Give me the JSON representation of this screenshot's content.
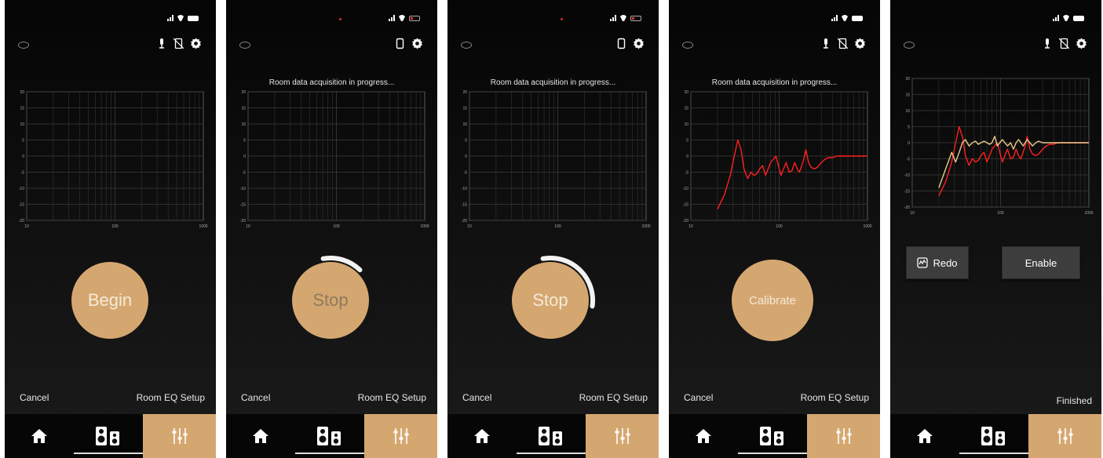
{
  "screens": [
    {
      "status": {
        "battery": "full",
        "red_dot": false
      },
      "top_icons": [
        "mic-icon",
        "phone-off-icon",
        "gear-icon"
      ],
      "message": "",
      "chart_data": {
        "type": "line",
        "y_ticks": [
          "20",
          "15",
          "10",
          "5",
          "0",
          "-5",
          "-10",
          "-15",
          "-20"
        ],
        "x_ticks": [
          "10",
          "100",
          "1000"
        ],
        "ylim": [
          -20,
          20
        ],
        "xlim": [
          10,
          1000
        ],
        "xscale": "log",
        "grid": true,
        "series": []
      },
      "action": {
        "kind": "circle",
        "label": "Begin",
        "progress": 0
      },
      "footer": {
        "left": "Cancel",
        "right": "Room EQ Setup"
      },
      "tabs": {
        "home_icon": "home-icon",
        "speaker_icon": "speakers-icon",
        "eq_icon": "eq-sliders-icon",
        "active": "eq"
      }
    },
    {
      "status": {
        "battery": "low",
        "red_dot": true
      },
      "top_icons": [
        "phone-icon",
        "gear-icon"
      ],
      "message": "Room data acquisition in progress...",
      "chart_data": {
        "type": "line",
        "y_ticks": [
          "20",
          "15",
          "10",
          "5",
          "0",
          "-5",
          "-10",
          "-15",
          "-20"
        ],
        "x_ticks": [
          "10",
          "100",
          "1000"
        ],
        "ylim": [
          -20,
          20
        ],
        "xlim": [
          10,
          1000
        ],
        "xscale": "log",
        "grid": true,
        "series": []
      },
      "action": {
        "kind": "circle",
        "label": "Stop",
        "progress": 0.15
      },
      "footer": {
        "left": "Cancel",
        "right": "Room EQ Setup"
      },
      "tabs": {
        "home_icon": "home-icon",
        "speaker_icon": "speakers-icon",
        "eq_icon": "eq-sliders-icon",
        "active": "eq"
      }
    },
    {
      "status": {
        "battery": "low",
        "red_dot": true
      },
      "top_icons": [
        "phone-icon",
        "gear-icon"
      ],
      "message": "Room data acquisition in progress...",
      "chart_data": {
        "type": "line",
        "y_ticks": [
          "20",
          "15",
          "10",
          "5",
          "0",
          "-5",
          "-10",
          "-15",
          "-20"
        ],
        "x_ticks": [
          "10",
          "100",
          "1000"
        ],
        "ylim": [
          -20,
          20
        ],
        "xlim": [
          10,
          1000
        ],
        "xscale": "log",
        "grid": true,
        "series": []
      },
      "action": {
        "kind": "circle",
        "label": "Stop",
        "progress": 0.3
      },
      "footer": {
        "left": "Cancel",
        "right": "Room EQ Setup"
      },
      "tabs": {
        "home_icon": "home-icon",
        "speaker_icon": "speakers-icon",
        "eq_icon": "eq-sliders-icon",
        "active": "eq"
      }
    },
    {
      "status": {
        "battery": "full",
        "red_dot": false
      },
      "top_icons": [
        "mic-icon",
        "phone-off-icon",
        "gear-icon"
      ],
      "message": "Room data acquisition in progress...",
      "chart_data": {
        "type": "line",
        "y_ticks": [
          "20",
          "15",
          "10",
          "5",
          "0",
          "-5",
          "-10",
          "-15",
          "-20"
        ],
        "x_ticks": [
          "10",
          "100",
          "1000"
        ],
        "ylim": [
          -20,
          20
        ],
        "xlim": [
          10,
          1000
        ],
        "xscale": "log",
        "grid": true,
        "series": [
          {
            "color": "#ff2020",
            "x": [
              20,
              24,
              28,
              31,
              34,
              37,
              40,
              44,
              48,
              52,
              56,
              60,
              65,
              70,
              75,
              80,
              86,
              92,
              98,
              105,
              112,
              120,
              130,
              140,
              150,
              160,
              170,
              180,
              190,
              200,
              215,
              230,
              250,
              270,
              300,
              330,
              360,
              400,
              450,
              500,
              600,
              700,
              800,
              900,
              1000
            ],
            "y": [
              -16.5,
              -12,
              -6,
              0,
              5,
              2,
              -4,
              -7,
              -5,
              -6,
              -5.5,
              -4,
              -3,
              -6,
              -4,
              -2,
              -1,
              0,
              -3,
              -6,
              -4,
              -2,
              -5,
              -4.5,
              -2,
              -4,
              -5,
              -3,
              -1,
              2,
              -2,
              -3.5,
              -4,
              -3.5,
              -2,
              -1,
              -0.5,
              -0.5,
              0,
              0,
              0,
              0,
              0,
              0,
              0
            ]
          }
        ]
      },
      "action": {
        "kind": "circle",
        "label": "Calibrate",
        "progress": 0
      },
      "footer": {
        "left": "Cancel",
        "right": "Room EQ Setup"
      },
      "tabs": {
        "home_icon": "home-icon",
        "speaker_icon": "speakers-icon",
        "eq_icon": "eq-sliders-icon",
        "active": "eq"
      }
    },
    {
      "status": {
        "battery": "full",
        "red_dot": false
      },
      "top_icons": [
        "mic-icon",
        "phone-off-icon",
        "gear-icon"
      ],
      "message": "",
      "chart_data": {
        "type": "line",
        "y_ticks": [
          "20",
          "15",
          "10",
          "5",
          "0",
          "-5",
          "-10",
          "-15",
          "-20"
        ],
        "x_ticks": [
          "10",
          "100",
          "1000"
        ],
        "ylim": [
          -20,
          20
        ],
        "xlim": [
          10,
          1000
        ],
        "xscale": "log",
        "grid": true,
        "series": [
          {
            "color": "#ff2020",
            "x": [
              20,
              24,
              28,
              31,
              34,
              37,
              40,
              44,
              48,
              52,
              56,
              60,
              65,
              70,
              75,
              80,
              86,
              92,
              98,
              105,
              112,
              120,
              130,
              140,
              150,
              160,
              170,
              180,
              190,
              200,
              215,
              230,
              250,
              270,
              300,
              330,
              360,
              400,
              450,
              500,
              600,
              700,
              800,
              900,
              1000
            ],
            "y": [
              -16.5,
              -12,
              -6,
              0,
              5,
              2,
              -4,
              -7,
              -5,
              -6,
              -5.5,
              -4,
              -3,
              -6,
              -4,
              -2,
              -1,
              0,
              -3,
              -6,
              -4,
              -2,
              -5,
              -4.5,
              -2,
              -4,
              -5,
              -3,
              -1,
              2,
              -2,
              -3.5,
              -4,
              -3.5,
              -2,
              -1,
              -0.5,
              -0.5,
              0,
              0,
              0,
              0,
              0,
              0,
              0
            ]
          },
          {
            "color": "#e8c98a",
            "x": [
              20,
              24,
              28,
              31,
              34,
              37,
              40,
              44,
              48,
              52,
              56,
              60,
              65,
              70,
              75,
              80,
              86,
              92,
              98,
              105,
              112,
              120,
              130,
              140,
              150,
              160,
              170,
              180,
              190,
              200,
              215,
              230,
              250,
              270,
              300,
              330,
              360,
              400,
              450,
              500,
              600,
              700,
              800,
              900,
              1000
            ],
            "y": [
              -14,
              -8,
              -3,
              -6,
              -3,
              0,
              1,
              -1,
              0,
              0.5,
              -0.5,
              0,
              0.5,
              0,
              -0.5,
              0,
              2,
              -1,
              0,
              1,
              0,
              -1,
              0,
              -2,
              0,
              1,
              0,
              -1,
              0,
              1,
              0,
              -1,
              0,
              0.5,
              0,
              0,
              0,
              0,
              0,
              0,
              0,
              0,
              0,
              0,
              0
            ]
          }
        ]
      },
      "action": {
        "kind": "buttons",
        "redo_label": "Redo",
        "redo_icon": "chart-icon",
        "enable_label": "Enable"
      },
      "footer": {
        "finished": "Finished"
      },
      "tabs": {
        "home_icon": "home-icon",
        "speaker_icon": "speakers-icon",
        "eq_icon": "eq-sliders-icon",
        "active": "eq"
      }
    }
  ]
}
